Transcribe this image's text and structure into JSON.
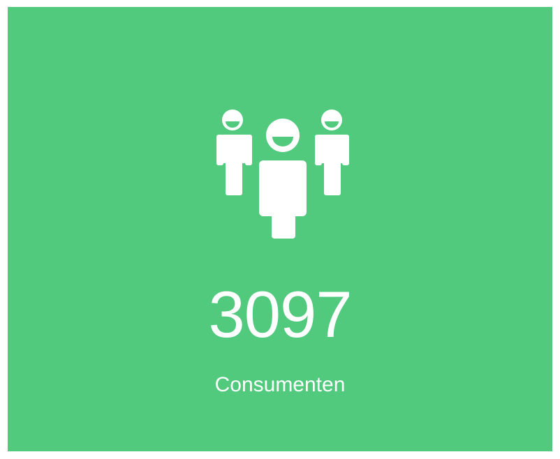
{
  "stat": {
    "icon": "users-group-icon",
    "value": "3097",
    "label": "Consumenten"
  },
  "colors": {
    "card_background": "#51ca7e",
    "foreground": "#ffffff",
    "page_background": "#ffffff"
  }
}
